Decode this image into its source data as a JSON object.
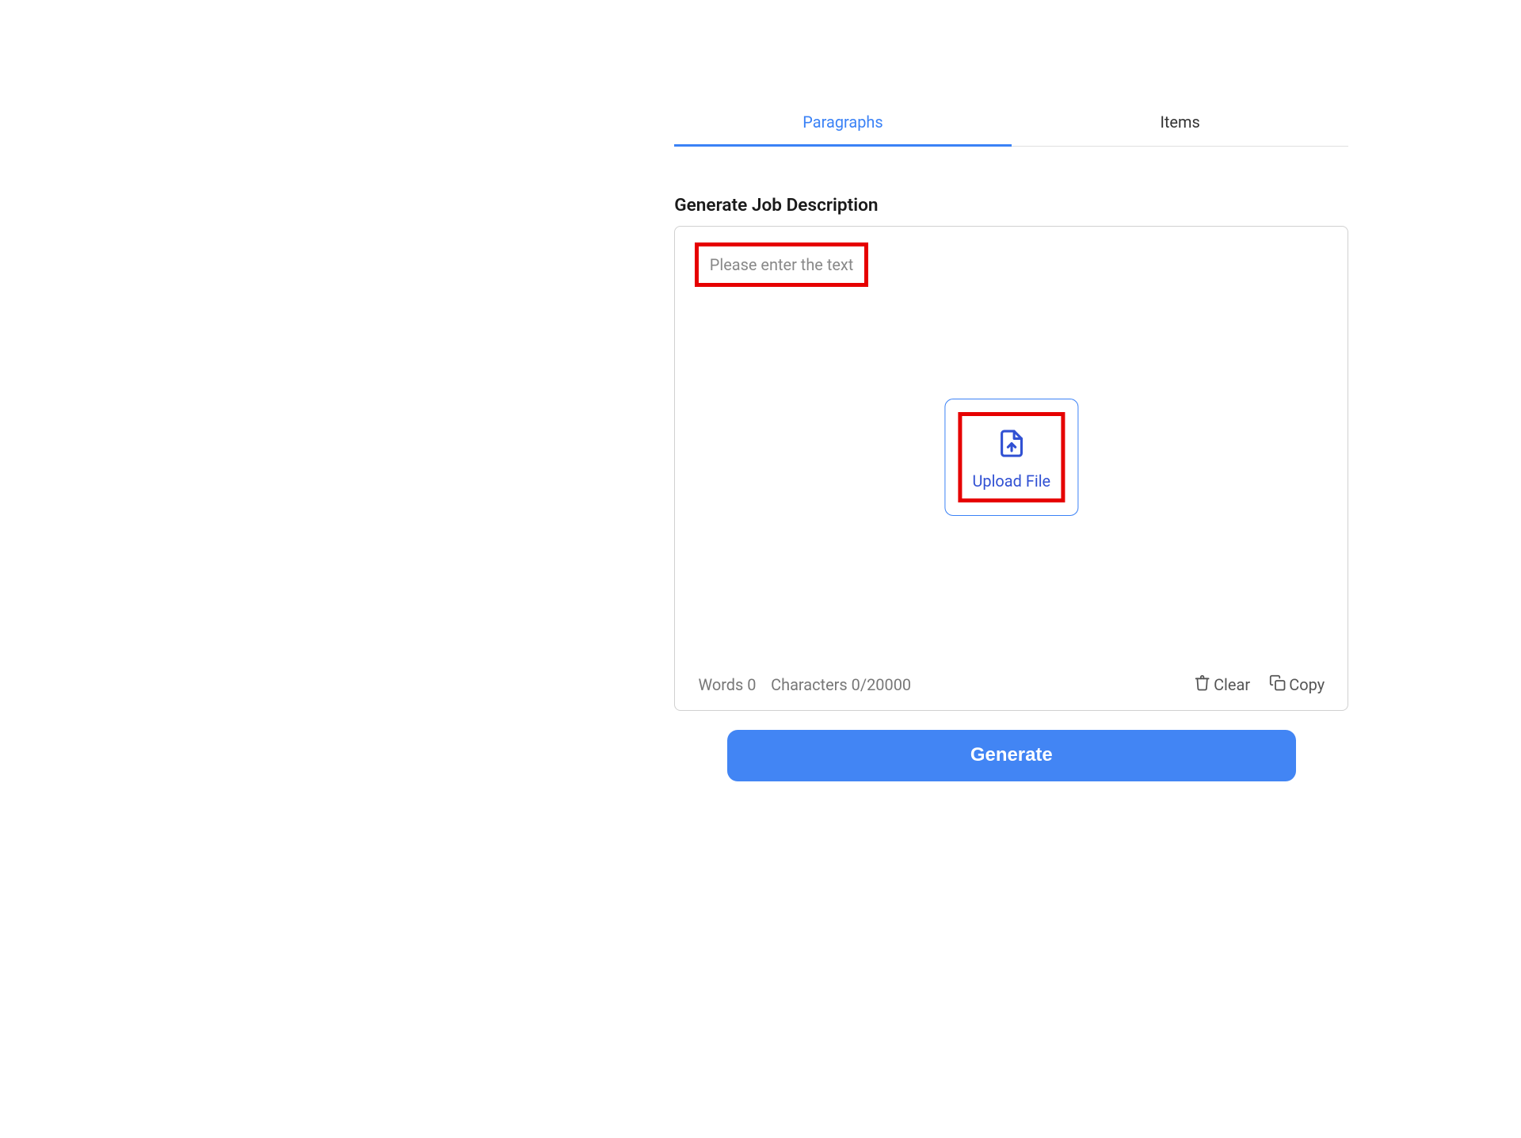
{
  "tabs": [
    {
      "label": "Paragraphs",
      "active": true
    },
    {
      "label": "Items",
      "active": false
    }
  ],
  "section_title": "Generate Job Description",
  "input": {
    "placeholder": "Please enter the text"
  },
  "upload": {
    "label": "Upload File"
  },
  "footer": {
    "words_label": "Words",
    "words_count": "0",
    "chars_label": "Characters",
    "chars_count": "0/20000",
    "clear_label": "Clear",
    "copy_label": "Copy"
  },
  "generate_label": "Generate"
}
